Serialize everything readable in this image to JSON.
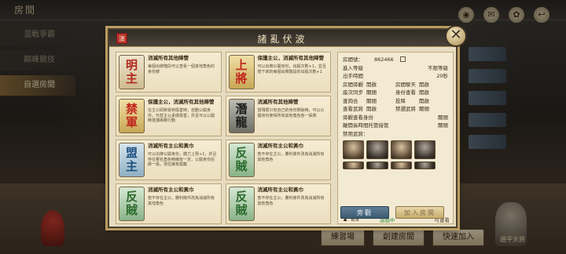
{
  "lobby": {
    "title": "房間",
    "menu": [
      "混戰爭霸",
      "巔峰競技",
      "自選房間"
    ],
    "bottom_buttons": [
      "練習場",
      "創建房間",
      "快速加入"
    ],
    "bg_character_label": "趙平天將"
  },
  "modal": {
    "title": "諸亂伏波",
    "seal": "演",
    "close": "✕"
  },
  "roles": [
    {
      "tile": "明主",
      "type": "lord",
      "head": "消滅所有其他陣營",
      "desc": "每個出牌階段可以查看一個其他角色的身份牌"
    },
    {
      "tile": "上將",
      "type": "loyal",
      "head": "保護主公，消滅所有其他陣營",
      "desc": "可以出牌公開身份，出殺次數+1，並且按下來的每個出牌階段的出殺次數+1"
    },
    {
      "tile": "禁軍",
      "type": "loyal",
      "head": "保護主公，消滅所有其他陣營",
      "desc": "在主公即將受到傷害時，自動公開身份，代替主公承擔傷害，并且可以公開時抵擋串聯行動"
    },
    {
      "tile": "潛龍",
      "type": "spy",
      "head": "消滅所有其他陣營",
      "desc": "當殘局只有自己的身份剩餘時，可以公開身份使得所有其他角色各一張牌"
    },
    {
      "tile": "盟主",
      "type": "rebel",
      "head": "消滅所有主公和黃巾",
      "desc": "可以出牌公開身份，體力上限+1，并且存在著名角色時擁有一定，公開身份后將一張，現在擁有獎勵"
    },
    {
      "tile": "反賊",
      "type": "traitor",
      "head": "消滅所有主公和黃巾",
      "desc": "若不存在主公，勝利條件改為消滅所有其他角色"
    },
    {
      "tile": "反賊",
      "type": "traitor",
      "head": "消滅所有主公和黃巾",
      "desc": "若不存在主公，勝利條件改為消滅所有其他角色"
    },
    {
      "tile": "反賊",
      "type": "traitor",
      "head": "消滅所有主公和黃巾",
      "desc": "若不存在主公，勝利條件改為消滅所有其他角色"
    }
  ],
  "room_info": {
    "room_no_label": "房間號：",
    "room_no": "862466",
    "entry_level_label": "進入等級",
    "entry_level": "不限等級",
    "play_time_label": "出手時間",
    "play_time": "20秒",
    "pairs": [
      [
        {
          "k": "房間旁觀",
          "v": "開啟"
        },
        {
          "k": "房間聊天",
          "v": "開啟"
        }
      ],
      [
        {
          "k": "座次同步",
          "v": "關閉"
        },
        {
          "k": "身份查看",
          "v": "開啟"
        }
      ],
      [
        {
          "k": "查詢合",
          "v": "關閉"
        },
        {
          "k": "投降",
          "v": "開啟"
        }
      ],
      [
        {
          "k": "查看武將",
          "v": "開啟"
        },
        {
          "k": "禁選武將",
          "v": "關閉"
        }
      ]
    ],
    "spectator_identity_label": "旁觀查看身份",
    "spectator_identity": "關閉",
    "afk_label": "離開長時間托管接管",
    "afk": "關閉",
    "banned_label": "禁用武將：",
    "players": "8/8",
    "status": "游戲中",
    "ratio": "可查看"
  },
  "actions": {
    "spectate": "旁觀",
    "join": "加入房間"
  }
}
